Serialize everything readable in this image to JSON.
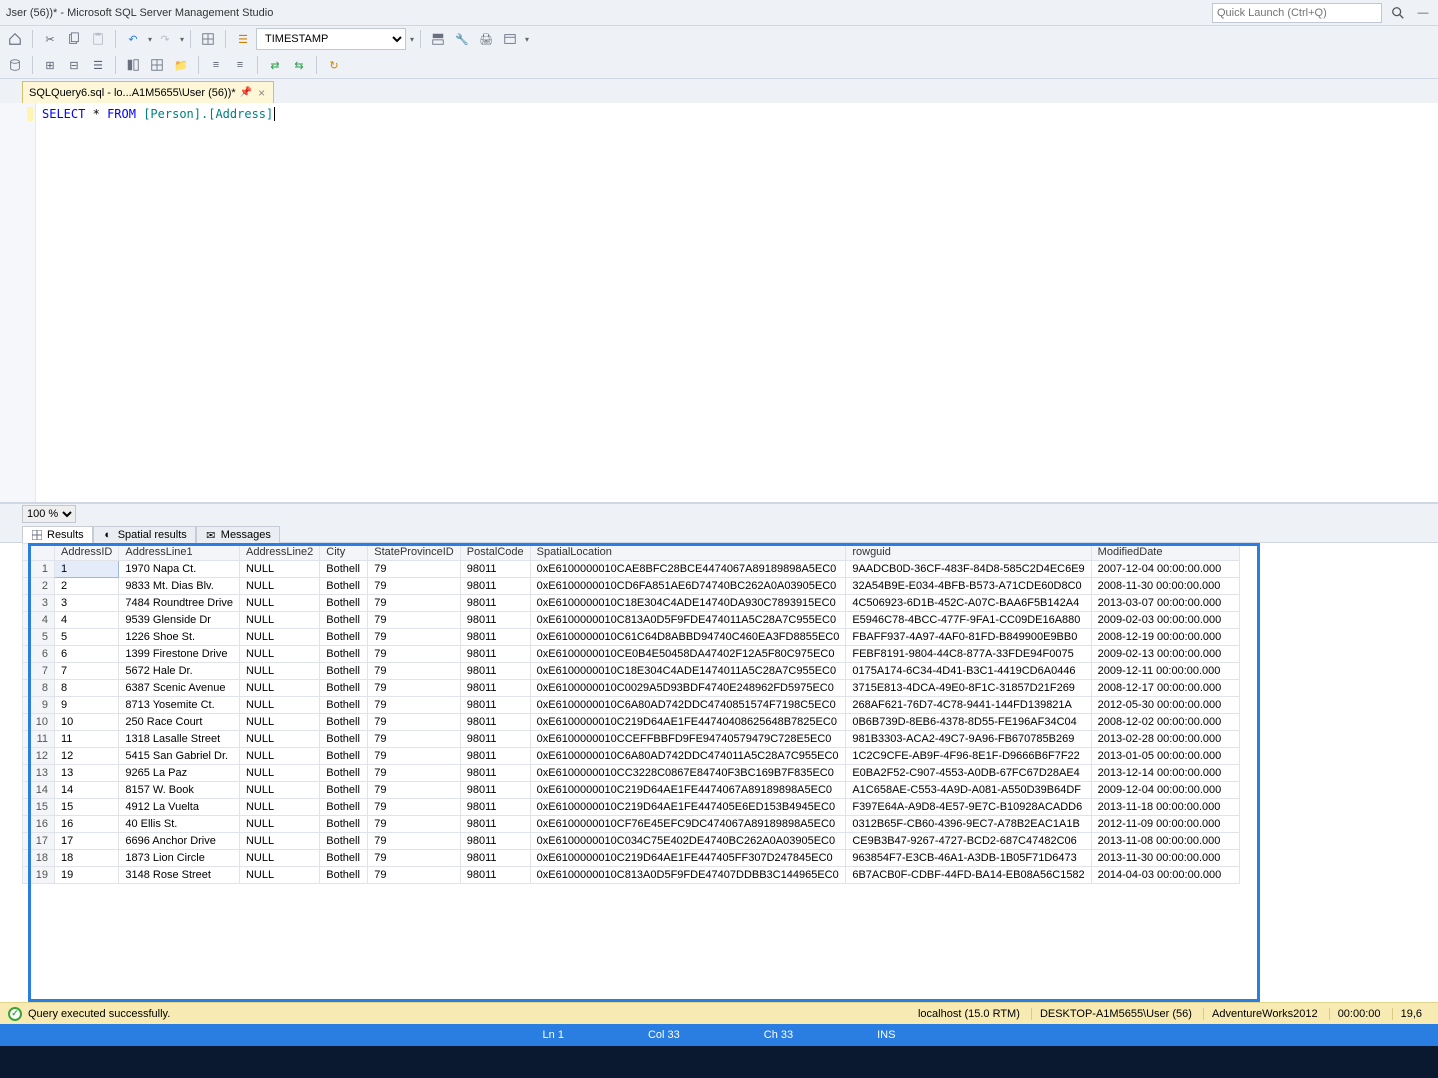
{
  "window": {
    "title": "Jser (56))* - Microsoft SQL Server Management Studio",
    "quicklaunch_placeholder": "Quick Launch (Ctrl+Q)"
  },
  "toolbar": {
    "timestamp_dropdown": "TIMESTAMP"
  },
  "doctab": {
    "label": "SQLQuery6.sql - lo...A1M5655\\User (56))*"
  },
  "editor": {
    "sql_select": "SELECT",
    "sql_star": "*",
    "sql_from": "FROM",
    "sql_tbl": "[Person].[Address]"
  },
  "zoom": {
    "value": "100 %"
  },
  "resulttabs": {
    "results": "Results",
    "spatial": "Spatial results",
    "messages": "Messages"
  },
  "grid": {
    "headers": [
      "AddressID",
      "AddressLine1",
      "AddressLine2",
      "City",
      "StateProvinceID",
      "PostalCode",
      "SpatialLocation",
      "rowguid",
      "ModifiedDate"
    ],
    "rows": [
      {
        "n": 1,
        "AddressID": "1",
        "AddressLine1": "1970 Napa Ct.",
        "AddressLine2": "NULL",
        "City": "Bothell",
        "StateProvinceID": "79",
        "PostalCode": "98011",
        "SpatialLocation": "0xE6100000010CAE8BFC28BCE4474067A89189898A5EC0",
        "rowguid": "9AADCB0D-36CF-483F-84D8-585C2D4EC6E9",
        "ModifiedDate": "2007-12-04 00:00:00.000"
      },
      {
        "n": 2,
        "AddressID": "2",
        "AddressLine1": "9833 Mt. Dias Blv.",
        "AddressLine2": "NULL",
        "City": "Bothell",
        "StateProvinceID": "79",
        "PostalCode": "98011",
        "SpatialLocation": "0xE6100000010CD6FA851AE6D74740BC262A0A03905EC0",
        "rowguid": "32A54B9E-E034-4BFB-B573-A71CDE60D8C0",
        "ModifiedDate": "2008-11-30 00:00:00.000"
      },
      {
        "n": 3,
        "AddressID": "3",
        "AddressLine1": "7484 Roundtree Drive",
        "AddressLine2": "NULL",
        "City": "Bothell",
        "StateProvinceID": "79",
        "PostalCode": "98011",
        "SpatialLocation": "0xE6100000010C18E304C4ADE14740DA930C7893915EC0",
        "rowguid": "4C506923-6D1B-452C-A07C-BAA6F5B142A4",
        "ModifiedDate": "2013-03-07 00:00:00.000"
      },
      {
        "n": 4,
        "AddressID": "4",
        "AddressLine1": "9539 Glenside Dr",
        "AddressLine2": "NULL",
        "City": "Bothell",
        "StateProvinceID": "79",
        "PostalCode": "98011",
        "SpatialLocation": "0xE6100000010C813A0D5F9FDE474011A5C28A7C955EC0",
        "rowguid": "E5946C78-4BCC-477F-9FA1-CC09DE16A880",
        "ModifiedDate": "2009-02-03 00:00:00.000"
      },
      {
        "n": 5,
        "AddressID": "5",
        "AddressLine1": "1226 Shoe St.",
        "AddressLine2": "NULL",
        "City": "Bothell",
        "StateProvinceID": "79",
        "PostalCode": "98011",
        "SpatialLocation": "0xE6100000010C61C64D8ABBD94740C460EA3FD8855EC0",
        "rowguid": "FBAFF937-4A97-4AF0-81FD-B849900E9BB0",
        "ModifiedDate": "2008-12-19 00:00:00.000"
      },
      {
        "n": 6,
        "AddressID": "6",
        "AddressLine1": "1399 Firestone Drive",
        "AddressLine2": "NULL",
        "City": "Bothell",
        "StateProvinceID": "79",
        "PostalCode": "98011",
        "SpatialLocation": "0xE6100000010CE0B4E50458DA47402F12A5F80C975EC0",
        "rowguid": "FEBF8191-9804-44C8-877A-33FDE94F0075",
        "ModifiedDate": "2009-02-13 00:00:00.000"
      },
      {
        "n": 7,
        "AddressID": "7",
        "AddressLine1": "5672 Hale Dr.",
        "AddressLine2": "NULL",
        "City": "Bothell",
        "StateProvinceID": "79",
        "PostalCode": "98011",
        "SpatialLocation": "0xE6100000010C18E304C4ADE1474011A5C28A7C955EC0",
        "rowguid": "0175A174-6C34-4D41-B3C1-4419CD6A0446",
        "ModifiedDate": "2009-12-11 00:00:00.000"
      },
      {
        "n": 8,
        "AddressID": "8",
        "AddressLine1": "6387 Scenic Avenue",
        "AddressLine2": "NULL",
        "City": "Bothell",
        "StateProvinceID": "79",
        "PostalCode": "98011",
        "SpatialLocation": "0xE6100000010C0029A5D93BDF4740E248962FD5975EC0",
        "rowguid": "3715E813-4DCA-49E0-8F1C-31857D21F269",
        "ModifiedDate": "2008-12-17 00:00:00.000"
      },
      {
        "n": 9,
        "AddressID": "9",
        "AddressLine1": "8713 Yosemite Ct.",
        "AddressLine2": "NULL",
        "City": "Bothell",
        "StateProvinceID": "79",
        "PostalCode": "98011",
        "SpatialLocation": "0xE6100000010C6A80AD742DDC4740851574F7198C5EC0",
        "rowguid": "268AF621-76D7-4C78-9441-144FD139821A",
        "ModifiedDate": "2012-05-30 00:00:00.000"
      },
      {
        "n": 10,
        "AddressID": "10",
        "AddressLine1": "250 Race Court",
        "AddressLine2": "NULL",
        "City": "Bothell",
        "StateProvinceID": "79",
        "PostalCode": "98011",
        "SpatialLocation": "0xE6100000010C219D64AE1FE44740408625648B7825EC0",
        "rowguid": "0B6B739D-8EB6-4378-8D55-FE196AF34C04",
        "ModifiedDate": "2008-12-02 00:00:00.000"
      },
      {
        "n": 11,
        "AddressID": "11",
        "AddressLine1": "1318 Lasalle Street",
        "AddressLine2": "NULL",
        "City": "Bothell",
        "StateProvinceID": "79",
        "PostalCode": "98011",
        "SpatialLocation": "0xE6100000010CCEFFBBFD9FE94740579479C728E5EC0",
        "rowguid": "981B3303-ACA2-49C7-9A96-FB670785B269",
        "ModifiedDate": "2013-02-28 00:00:00.000"
      },
      {
        "n": 12,
        "AddressID": "12",
        "AddressLine1": "5415 San Gabriel Dr.",
        "AddressLine2": "NULL",
        "City": "Bothell",
        "StateProvinceID": "79",
        "PostalCode": "98011",
        "SpatialLocation": "0xE6100000010C6A80AD742DDC474011A5C28A7C955EC0",
        "rowguid": "1C2C9CFE-AB9F-4F96-8E1F-D9666B6F7F22",
        "ModifiedDate": "2013-01-05 00:00:00.000"
      },
      {
        "n": 13,
        "AddressID": "13",
        "AddressLine1": "9265 La Paz",
        "AddressLine2": "NULL",
        "City": "Bothell",
        "StateProvinceID": "79",
        "PostalCode": "98011",
        "SpatialLocation": "0xE6100000010CC3228C0867E84740F3BC169B7F835EC0",
        "rowguid": "E0BA2F52-C907-4553-A0DB-67FC67D28AE4",
        "ModifiedDate": "2013-12-14 00:00:00.000"
      },
      {
        "n": 14,
        "AddressID": "14",
        "AddressLine1": "8157 W. Book",
        "AddressLine2": "NULL",
        "City": "Bothell",
        "StateProvinceID": "79",
        "PostalCode": "98011",
        "SpatialLocation": "0xE6100000010C219D64AE1FE4474067A89189898A5EC0",
        "rowguid": "A1C658AE-C553-4A9D-A081-A550D39B64DF",
        "ModifiedDate": "2009-12-04 00:00:00.000"
      },
      {
        "n": 15,
        "AddressID": "15",
        "AddressLine1": "4912 La Vuelta",
        "AddressLine2": "NULL",
        "City": "Bothell",
        "StateProvinceID": "79",
        "PostalCode": "98011",
        "SpatialLocation": "0xE6100000010C219D64AE1FE447405E6ED153B4945EC0",
        "rowguid": "F397E64A-A9D8-4E57-9E7C-B10928ACADD6",
        "ModifiedDate": "2013-11-18 00:00:00.000"
      },
      {
        "n": 16,
        "AddressID": "16",
        "AddressLine1": "40 Ellis St.",
        "AddressLine2": "NULL",
        "City": "Bothell",
        "StateProvinceID": "79",
        "PostalCode": "98011",
        "SpatialLocation": "0xE6100000010CF76E45EFC9DC474067A89189898A5EC0",
        "rowguid": "0312B65F-CB60-4396-9EC7-A78B2EAC1A1B",
        "ModifiedDate": "2012-11-09 00:00:00.000"
      },
      {
        "n": 17,
        "AddressID": "17",
        "AddressLine1": "6696 Anchor Drive",
        "AddressLine2": "NULL",
        "City": "Bothell",
        "StateProvinceID": "79",
        "PostalCode": "98011",
        "SpatialLocation": "0xE6100000010C034C75E402DE4740BC262A0A03905EC0",
        "rowguid": "CE9B3B47-9267-4727-BCD2-687C47482C06",
        "ModifiedDate": "2013-11-08 00:00:00.000"
      },
      {
        "n": 18,
        "AddressID": "18",
        "AddressLine1": "1873 Lion Circle",
        "AddressLine2": "NULL",
        "City": "Bothell",
        "StateProvinceID": "79",
        "PostalCode": "98011",
        "SpatialLocation": "0xE6100000010C219D64AE1FE447405FF307D247845EC0",
        "rowguid": "963854F7-E3CB-46A1-A3DB-1B05F71D6473",
        "ModifiedDate": "2013-11-30 00:00:00.000"
      },
      {
        "n": 19,
        "AddressID": "19",
        "AddressLine1": "3148 Rose Street",
        "AddressLine2": "NULL",
        "City": "Bothell",
        "StateProvinceID": "79",
        "PostalCode": "98011",
        "SpatialLocation": "0xE6100000010C813A0D5F9FDE47407DDBB3C144965EC0",
        "rowguid": "6B7ACB0F-CDBF-44FD-BA14-EB08A56C1582",
        "ModifiedDate": "2014-04-03 00:00:00.000"
      }
    ]
  },
  "statusbar1": {
    "query_ok": "Query executed successfully.",
    "server": "localhost (15.0 RTM)",
    "user": "DESKTOP-A1M5655\\User (56)",
    "db": "AdventureWorks2012",
    "elapsed": "00:00:00",
    "rows": "19,6"
  },
  "statusbar2": {
    "ln": "Ln 1",
    "col": "Col 33",
    "ch": "Ch 33",
    "ins": "INS"
  }
}
